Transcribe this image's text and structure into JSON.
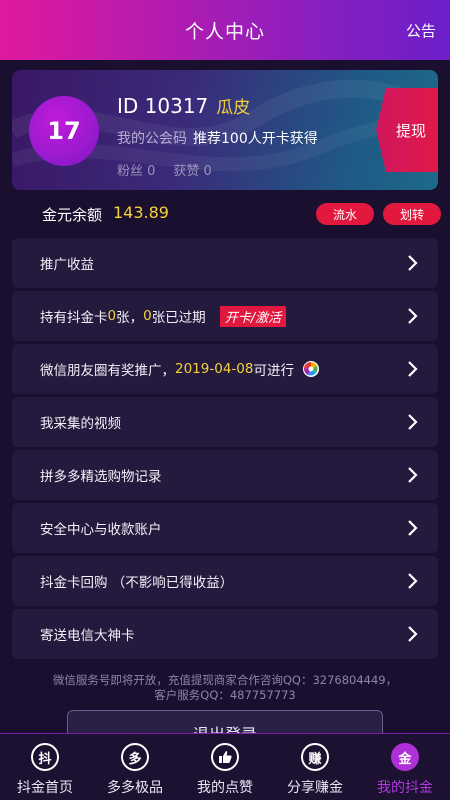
{
  "header": {
    "title": "个人中心",
    "notice": "公告"
  },
  "card": {
    "level": "17",
    "id_text": "ID 10317",
    "nickname": "瓜皮",
    "code_label": "我的公会码",
    "code_value": "推荐100人开卡获得",
    "fans": "粉丝 0",
    "likes": "获赞 0",
    "withdraw": "提现"
  },
  "balance": {
    "label": "金元余额",
    "value": "143.89",
    "flow": "流水",
    "transfer": "划转"
  },
  "menu": {
    "promo_income": "推广收益",
    "card_prefix": "持有抖金卡",
    "card_count": "0",
    "card_mid": "张，",
    "card_expired": "0",
    "card_suffix": "张已过期",
    "card_action": "开卡/激活",
    "moments_prefix": "微信朋友圈有奖推广，",
    "moments_date": "2019-04-08",
    "moments_suffix": "可进行",
    "videos": "我采集的视频",
    "pdd": "拼多多精选购物记录",
    "security": "安全中心与收款账户",
    "buyback": "抖金卡回购  （不影响已得收益）",
    "telecom": "寄送电信大神卡"
  },
  "footer": {
    "line1": "微信服务号即将开放，充值提现商家合作咨询QQ：3276804449，",
    "line2": "客户服务QQ：487757773"
  },
  "logout": "退出登录",
  "tabs": {
    "home": {
      "icon": "抖",
      "label": "抖金首页"
    },
    "deals": {
      "icon": "多",
      "label": "多多极品"
    },
    "likes": {
      "label": "我的点赞"
    },
    "share": {
      "icon": "赚",
      "label": "分享赚金"
    },
    "mine": {
      "icon": "金",
      "label": "我的抖金"
    }
  },
  "colors": {
    "accent": "#e3183f",
    "gold": "#f5d23a",
    "active_tab": "#b03ae0"
  }
}
